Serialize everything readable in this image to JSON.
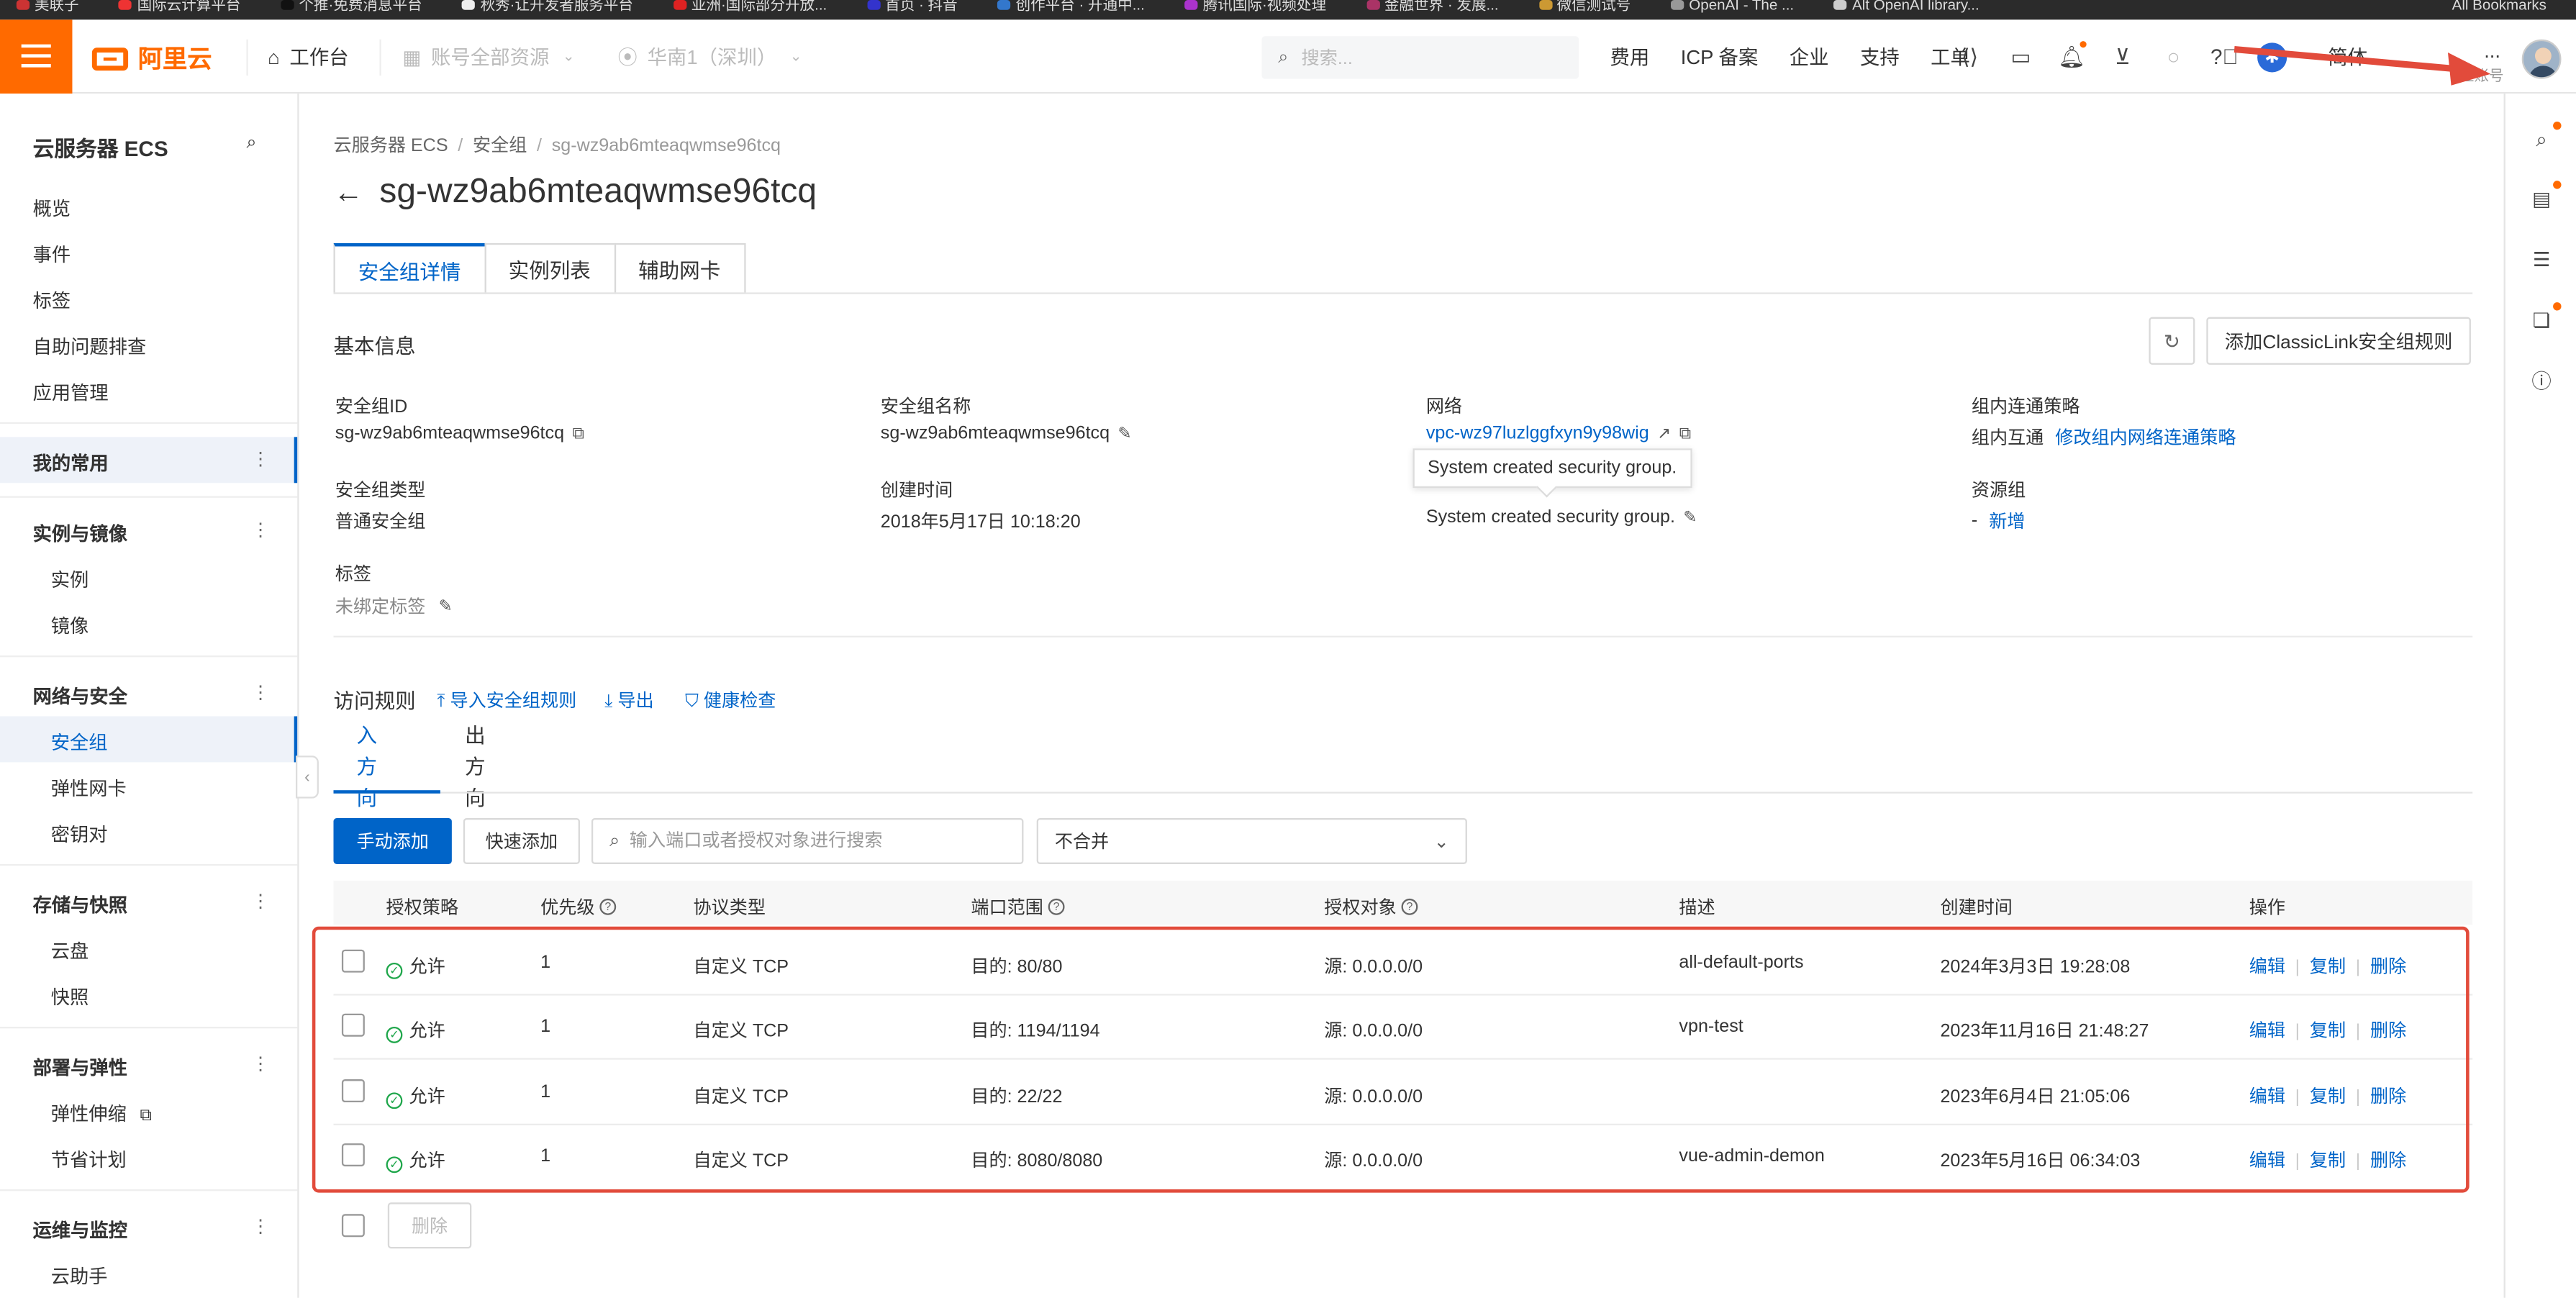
{
  "bookmarks": [
    "美联子",
    "国际云计算平台",
    "个推·免费消息平台",
    "秋秀·让开发者服务平台",
    "亚洲·国际部分开放...",
    "首页 · 抖音",
    "创作平台 · 开通中...",
    "腾讯国际·视频处理",
    "金融世界 · 发展...",
    "微信测试号",
    "OpenAI - The ...",
    "Alt OpenAI library..."
  ],
  "bookmarks_right": "All Bookmarks",
  "topnav": {
    "brand": "阿里云",
    "workbench": "工作台",
    "resources": "账号全部资源",
    "region": "华南1（深圳）",
    "search_placeholder": "搜索...",
    "links": [
      "费用",
      "ICP 备案",
      "企业",
      "支持",
      "工单"
    ],
    "lang": "简体",
    "account_role": "主账号",
    "account_name": "..."
  },
  "sidebar": {
    "title": "云服务器 ECS",
    "top_items": [
      "概览",
      "事件",
      "标签",
      "自助问题排查",
      "应用管理"
    ],
    "favorites": "我的常用",
    "sections": [
      {
        "title": "实例与镜像",
        "items": [
          "实例",
          "镜像"
        ]
      },
      {
        "title": "网络与安全",
        "items": [
          "安全组",
          "弹性网卡",
          "密钥对"
        ]
      },
      {
        "title": "存储与快照",
        "items": [
          "云盘",
          "快照"
        ]
      },
      {
        "title": "部署与弹性",
        "items": [
          "弹性伸缩",
          "节省计划"
        ]
      },
      {
        "title": "运维与监控",
        "items": [
          "云助手"
        ]
      }
    ]
  },
  "breadcrumb": [
    "云服务器 ECS",
    "安全组",
    "sg-wz9ab6mteaqwmse96tcq"
  ],
  "page_title": "sg-wz9ab6mteaqwmse96tcq",
  "tabs": [
    "安全组详情",
    "实例列表",
    "辅助网卡"
  ],
  "basic": {
    "title": "基本信息",
    "add_classiclink": "添加ClassicLink安全组规则",
    "fields": {
      "id_label": "安全组ID",
      "id_value": "sg-wz9ab6mteaqwmse96tcq",
      "name_label": "安全组名称",
      "name_value": "sg-wz9ab6mteaqwmse96tcq",
      "network_label": "网络",
      "network_value": "vpc-wz97luzlggfxyn9y98wig",
      "policy_label": "组内连通策略",
      "policy_value": "组内互通",
      "policy_link": "修改组内网络连通策略",
      "type_label": "安全组类型",
      "type_value": "普通安全组",
      "created_label": "创建时间",
      "created_value": "2018年5月17日 10:18:20",
      "desc_value": "System created security group.",
      "rg_label": "资源组",
      "rg_value": "-",
      "rg_link": "新增",
      "tag_label": "标签",
      "tag_value": "未绑定标签"
    },
    "tooltip": "System created security group."
  },
  "rules": {
    "title": "访问规则",
    "import": "导入安全组规则",
    "export": "导出",
    "health": "健康检查",
    "dir_in": "入方向",
    "dir_out": "出方向",
    "add_manual": "手动添加",
    "add_quick": "快速添加",
    "search_placeholder": "输入端口或者授权对象进行搜索",
    "merge_select": "不合并",
    "columns": [
      "授权策略",
      "优先级",
      "协议类型",
      "端口范围",
      "授权对象",
      "描述",
      "创建时间",
      "操作"
    ],
    "rows": [
      {
        "policy": "允许",
        "priority": "1",
        "protocol": "自定义 TCP",
        "port": "目的: 80/80",
        "source": "源: 0.0.0.0/0",
        "desc": "all-default-ports",
        "created": "2024年3月3日 19:28:08"
      },
      {
        "policy": "允许",
        "priority": "1",
        "protocol": "自定义 TCP",
        "port": "目的: 1194/1194",
        "source": "源: 0.0.0.0/0",
        "desc": "vpn-test",
        "created": "2023年11月16日 21:48:27"
      },
      {
        "policy": "允许",
        "priority": "1",
        "protocol": "自定义 TCP",
        "port": "目的: 22/22",
        "source": "源: 0.0.0.0/0",
        "desc": "",
        "created": "2023年6月4日 21:05:06"
      },
      {
        "policy": "允许",
        "priority": "1",
        "protocol": "自定义 TCP",
        "port": "目的: 8080/8080",
        "source": "源: 0.0.0.0/0",
        "desc": "vue-admin-demon",
        "created": "2023年5月16日 06:34:03"
      }
    ],
    "ops": {
      "edit": "编辑",
      "copy": "复制",
      "delete": "删除"
    },
    "bulk_delete": "删除"
  },
  "colors": {
    "accent": "#0064c8",
    "brand": "#ff6a00",
    "highlight": "#e24b3b",
    "allow": "#1ea64a"
  }
}
